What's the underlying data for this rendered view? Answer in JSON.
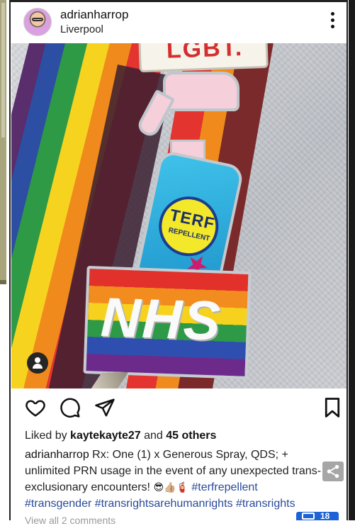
{
  "post": {
    "username": "adrianharrop",
    "location": "Liverpool"
  },
  "photo": {
    "pin_top_text": "LGBT.",
    "spray_label_main": "TERF",
    "spray_label_sub": "REPELLENT",
    "nhs_text": "NHS"
  },
  "likes": {
    "prefix": "Liked by ",
    "user": "kaytekayte27",
    "middle": " and ",
    "others": "45 others"
  },
  "caption": {
    "user": "adrianharrop",
    "text": " Rx: One (1) x Generous Spray, QDS; + unlimited PRN usage in the event of any unexpected trans-exclusionary encounters! ",
    "emoji": "😎👍🏼🧯",
    "hashtags": [
      "#terfrepellent",
      "#transgender",
      "#transrightsarehumanrights",
      "#transrights"
    ]
  },
  "comments": {
    "view_all": "View all 2 comments"
  },
  "badge": {
    "count": "18"
  },
  "icons": {
    "more": "more-vertical-icon",
    "like": "heart-outline-icon",
    "comment": "speech-bubble-icon",
    "share": "paper-plane-icon",
    "save": "bookmark-outline-icon",
    "user_tag": "user-tag-icon",
    "share_fab": "share-icon"
  },
  "colors": {
    "hashtag": "#2a4a9a",
    "share_fab_bg": "#a6a6a6",
    "badge_bg": "#1e63d6"
  }
}
